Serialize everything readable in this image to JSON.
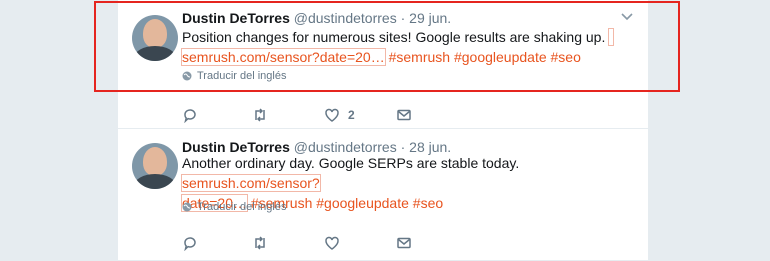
{
  "tweets": [
    {
      "name": "Dustin DeTorres",
      "handle": "@dustindetorres",
      "separator": "·",
      "date": "29 jun.",
      "text_line1": "Position changes for numerous sites! Google results are shaking up.",
      "link_text": "semrush.com/sensor?date=20…",
      "hashtags": "#semrush #googleupdate #seo",
      "translate_label": "Traducir del inglés",
      "like_count": "2"
    },
    {
      "name": "Dustin DeTorres",
      "handle": "@dustindetorres",
      "separator": "·",
      "date": "28 jun.",
      "text_line1": "Another ordinary day. Google SERPs are stable today.",
      "link_part1": "semrush.com/sensor?",
      "link_part2": "date=20…",
      "hashtags": "#semrush #googleupdate #seo",
      "translate_label": "Traducir del inglés"
    }
  ],
  "icons": {
    "reply": "reply-icon",
    "retweet": "retweet-icon",
    "like": "heart-icon",
    "dm": "envelope-icon",
    "menu": "chevron-down-icon",
    "translate": "globe-icon"
  },
  "colors": {
    "link": "#e8541f",
    "highlight": "#e5251f",
    "muted": "#657786"
  }
}
